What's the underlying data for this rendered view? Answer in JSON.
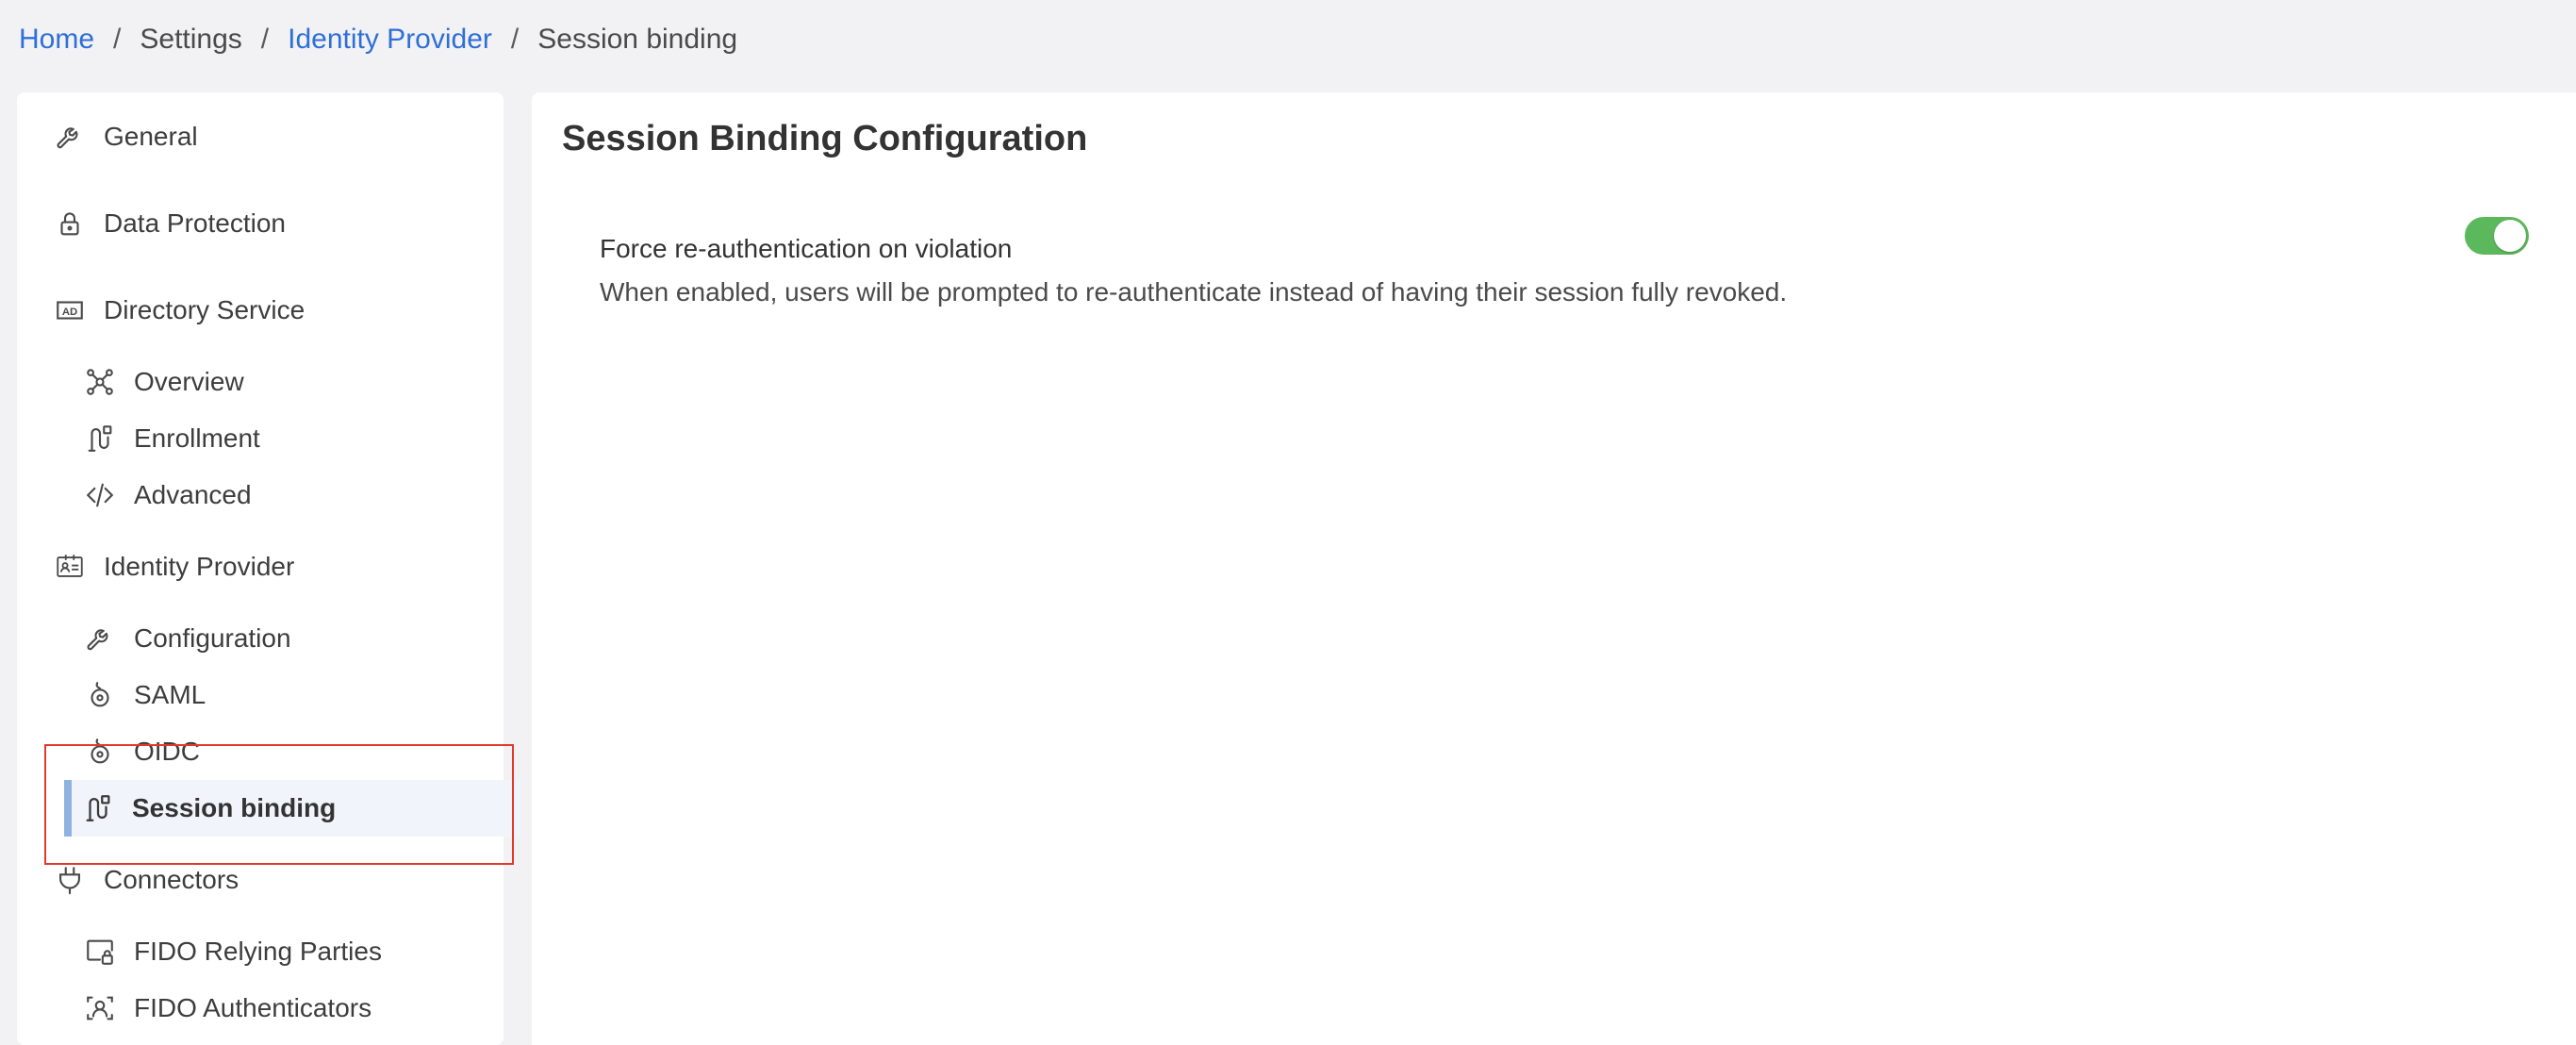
{
  "breadcrumb": {
    "items": [
      "Home",
      "Settings",
      "Identity Provider",
      "Session binding"
    ],
    "separator": "/"
  },
  "sidebar": {
    "items": [
      {
        "label": "General",
        "icon": "wrench-icon"
      },
      {
        "label": "Data Protection",
        "icon": "lock-icon"
      },
      {
        "label": "Directory Service",
        "icon": "ad-icon"
      },
      {
        "label": "Overview",
        "icon": "network-icon"
      },
      {
        "label": "Enrollment",
        "icon": "flow-icon"
      },
      {
        "label": "Advanced",
        "icon": "code-icon"
      },
      {
        "label": "Identity Provider",
        "icon": "id-card-icon"
      },
      {
        "label": "Configuration",
        "icon": "wrench-icon"
      },
      {
        "label": "SAML",
        "icon": "openid-icon"
      },
      {
        "label": "OIDC",
        "icon": "openid-icon"
      },
      {
        "label": "Session binding",
        "icon": "flow-icon"
      },
      {
        "label": "Connectors",
        "icon": "plug-icon"
      },
      {
        "label": "FIDO Relying Parties",
        "icon": "monitor-lock-icon"
      },
      {
        "label": "FIDO Authenticators",
        "icon": "face-scan-icon"
      }
    ],
    "active_index": 10
  },
  "main": {
    "title": "Session Binding Configuration",
    "setting": {
      "label": "Force re-authentication on violation",
      "description": "When enabled, users will be prompted to re-authenticate instead of having their session fully revoked.",
      "enabled": true
    }
  },
  "colors": {
    "link": "#2f6fd6",
    "toggle_on": "#5cb85c",
    "active_bar": "#8fb3e0",
    "highlight": "#e23a2a"
  }
}
